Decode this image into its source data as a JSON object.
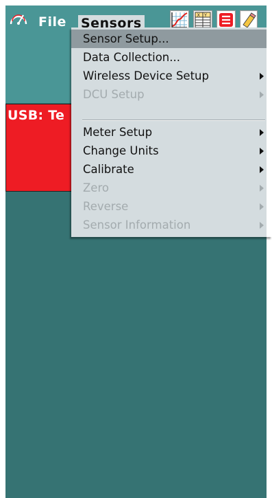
{
  "menubar": {
    "file_label": "File",
    "sensors_label": "Sensors",
    "toolbar_icons": [
      "graph-icon",
      "table-icon",
      "list-icon",
      "notes-icon"
    ]
  },
  "meter": {
    "label": "USB: Te",
    "color": "#ee1c24"
  },
  "dropdown": {
    "items": [
      {
        "label": "Sensor Setup...",
        "enabled": true,
        "submenu": false
      },
      {
        "label": "Data Collection...",
        "enabled": true,
        "submenu": false
      },
      {
        "label": "Wireless Device Setup",
        "enabled": true,
        "submenu": true
      },
      {
        "label": "DCU Setup",
        "enabled": false,
        "submenu": true
      },
      {
        "label": "Meter Setup",
        "enabled": true,
        "submenu": true
      },
      {
        "label": "Change Units",
        "enabled": true,
        "submenu": true
      },
      {
        "label": "Calibrate",
        "enabled": true,
        "submenu": true
      },
      {
        "label": "Zero",
        "enabled": false,
        "submenu": true
      },
      {
        "label": "Reverse",
        "enabled": false,
        "submenu": true
      },
      {
        "label": "Sensor Information",
        "enabled": false,
        "submenu": true
      }
    ]
  },
  "colors": {
    "background": "#367373",
    "menubar": "#4a9696",
    "menu_bg": "#d4dcdf",
    "highlight": "#8f9a9f",
    "disabled_text": "#a3abae"
  }
}
